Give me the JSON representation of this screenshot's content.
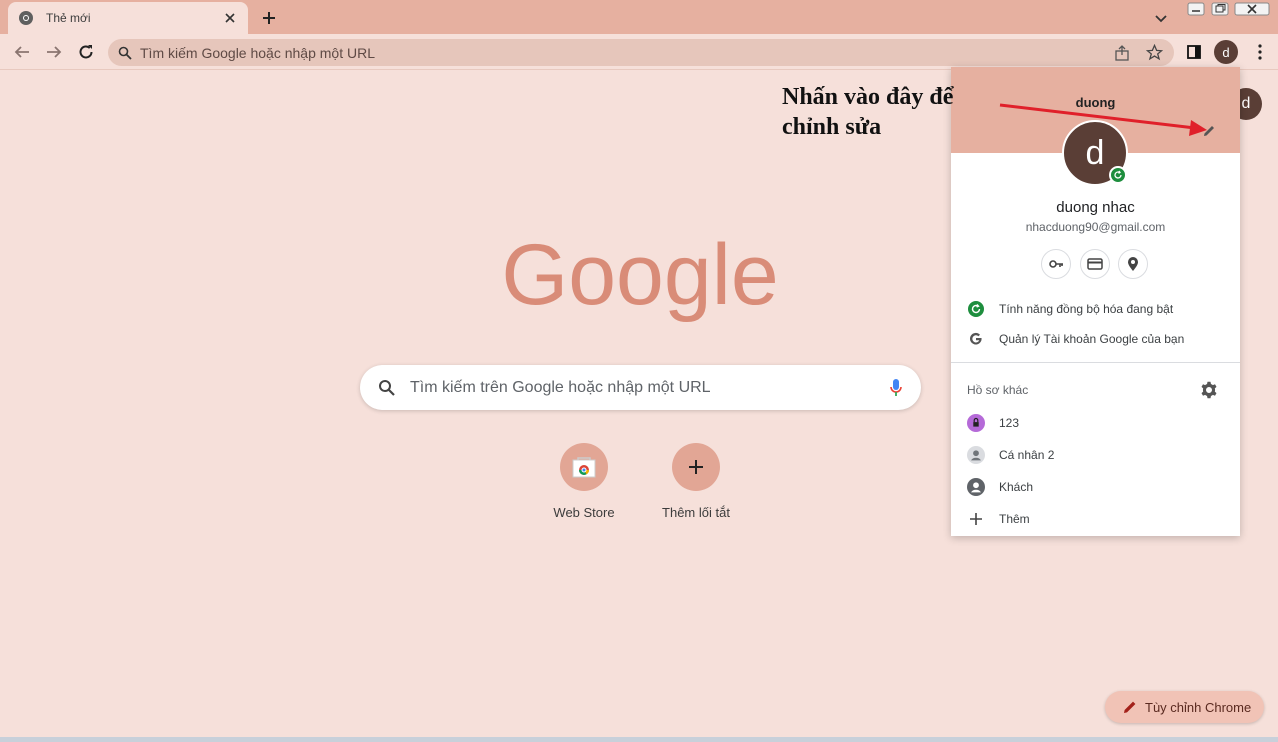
{
  "tab": {
    "title": "Thẻ mới",
    "favicon": "chrome-icon"
  },
  "toolbar": {
    "omnibox_placeholder": "Tìm kiếm Google hoặc nhập một URL",
    "profile_initial": "d"
  },
  "ntp": {
    "logo_text": "Google",
    "search_placeholder": "Tìm kiếm trên Google hoặc nhập một URL",
    "shortcuts": [
      {
        "label": "Web Store",
        "icon": "web-store-icon"
      },
      {
        "label": "Thêm lối tắt",
        "icon": "plus-icon"
      }
    ],
    "avatar_initial": "d",
    "customize_label": "Tùy chỉnh Chrome"
  },
  "annotation": {
    "line1": "Nhấn vào đây để",
    "line2": "chỉnh sửa"
  },
  "profile_panel": {
    "header_name": "duong",
    "avatar_initial": "d",
    "full_name": "duong nhac",
    "email": "nhacduong90@gmail.com",
    "quick_actions": [
      "key-icon",
      "card-icon",
      "location-icon"
    ],
    "sync_label": "Tính năng đồng bộ hóa đang bật",
    "manage_label": "Quản lý Tài khoản Google của bạn",
    "other_profiles_title": "Hồ sơ khác",
    "other_profiles": [
      {
        "label": "123",
        "icon": "profile-lock-icon"
      },
      {
        "label": "Cá nhân 2",
        "icon": "person-icon"
      },
      {
        "label": "Khách",
        "icon": "guest-icon"
      },
      {
        "label": "Thêm",
        "icon": "plus-icon"
      }
    ]
  },
  "colors": {
    "frame": "#e6b0a0",
    "background": "#f6e0da",
    "logo": "#d98c78",
    "avatar": "#5a3e36",
    "sync_green": "#1e8e3e",
    "arrow": "#e0202a"
  }
}
